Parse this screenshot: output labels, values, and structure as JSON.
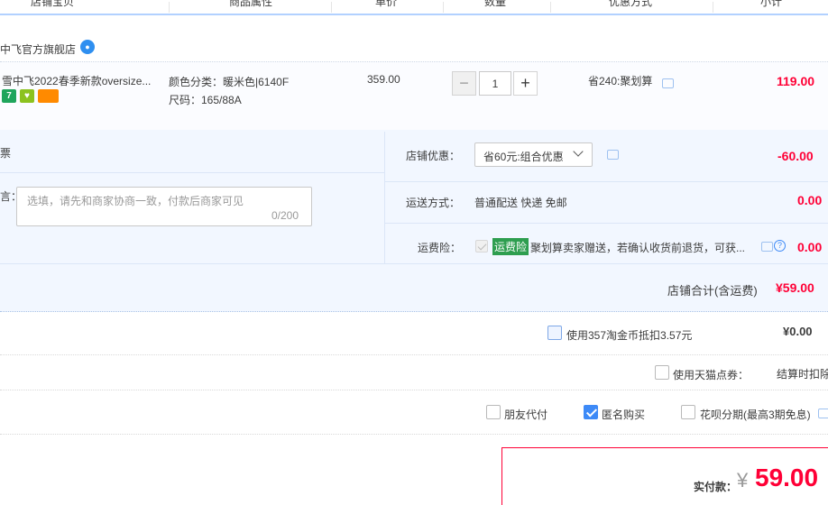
{
  "header": {
    "columns": [
      "店铺宝贝",
      "商品属性",
      "单价",
      "数量",
      "优惠方式",
      "小计"
    ]
  },
  "shop": {
    "name": "中飞官方旗舰店",
    "chat_icon": "wangwang-chat-icon"
  },
  "item": {
    "title": "雪中飞2022春季新款oversize...",
    "tags": [
      {
        "text": "7",
        "color": "#1fa55c"
      },
      {
        "text": "♥",
        "color": "#8cc21f"
      },
      {
        "text": "▬",
        "color": "#ff8a00"
      }
    ],
    "attr_color": "颜色分类：暖米色|6140F",
    "attr_size": "尺码：165/88A",
    "price": "359.00",
    "quantity": "1",
    "minus": "−",
    "plus": "+",
    "discount": "省240:聚划算",
    "subtotal": "119.00"
  },
  "panel": {
    "invoice_label": "票",
    "message_label": "言：",
    "message_placeholder": "选填，请先和商家协商一致，付款后商家可见",
    "message_count": "0/200",
    "shop_discount_label": "店铺优惠：",
    "shop_discount_value": "省60元:组合优惠",
    "shop_discount_amount": "-60.00",
    "shipping_label": "运送方式：",
    "shipping_value": "普通配送 快递 免邮",
    "shipping_amount": "0.00",
    "insurance_label": "运费险：",
    "insurance_badge": "运费险",
    "insurance_text": "聚划算卖家赠送，若确认收货前退货，可获...",
    "insurance_amount": "0.00",
    "total_label": "店铺合计(含运费)",
    "total_amount": "¥59.00"
  },
  "options": {
    "coin_label": "使用357淘金币抵扣3.57元",
    "coin_amount": "¥0.00",
    "tmall_points_label": "使用天猫点券：",
    "tmall_points_value": "结算时扣除",
    "friend_pay_label": "朋友代付",
    "anonymous_label": "匿名购买",
    "huabei_label": "花呗分期(最高3期免息)"
  },
  "payment": {
    "label": "实付款：",
    "currency": "¥",
    "amount": "59.00"
  },
  "colors": {
    "accent_red": "#ff0036",
    "accent_blue": "#3d8af7",
    "panel_bg": "#f2f7ff",
    "insurance_green": "#2e9e4f"
  }
}
